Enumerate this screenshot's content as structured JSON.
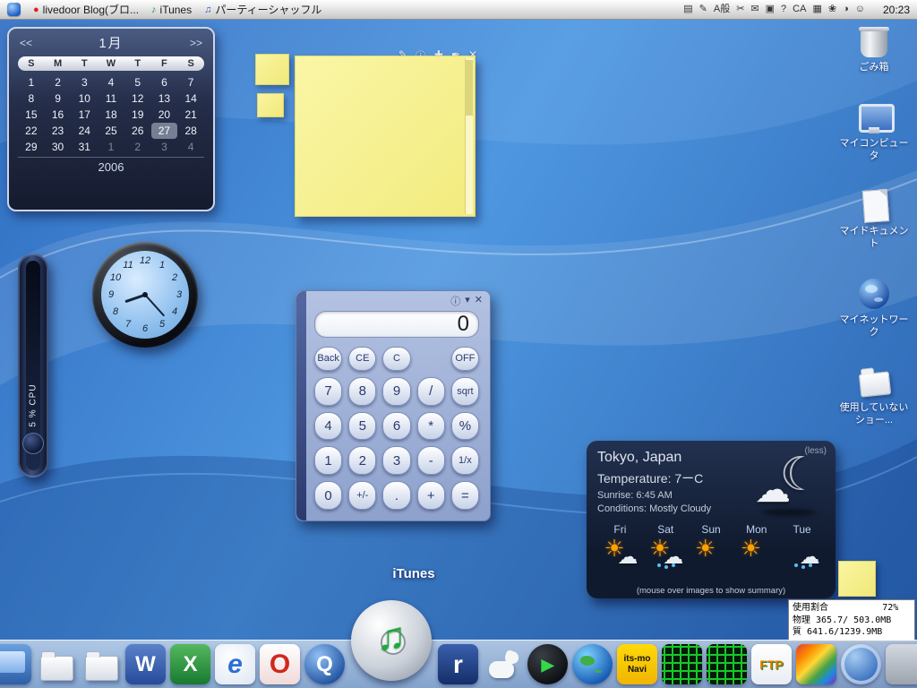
{
  "colors": {
    "wallpaper_blue": "#3a78c8",
    "note_yellow": "#f5ef8e",
    "widget_navy": "#1b2740",
    "dock_silver": "#e8ecf2",
    "calendar_selection_gray": "#cdd6e6",
    "sun_orange": "#ffa000",
    "itunes_green": "#23a83c"
  },
  "menubar": {
    "items": [
      {
        "name": "menu-livedoor-blog",
        "glyph": "●",
        "glyph_class": "red",
        "label": "livedoor Blog(ブロ..."
      },
      {
        "name": "menu-itunes",
        "glyph": "♪",
        "glyph_class": "green",
        "label": "iTunes"
      },
      {
        "name": "menu-party-shuffle",
        "glyph": "♫",
        "glyph_class": "blue",
        "label": "パーティーシャッフル"
      }
    ],
    "tray_icons": [
      {
        "name": "printer-icon",
        "glyph": "▤"
      },
      {
        "name": "pen-icon",
        "glyph": "✎"
      },
      {
        "name": "ime-indicator",
        "glyph": "A般"
      },
      {
        "name": "scissors-icon",
        "glyph": "✂"
      },
      {
        "name": "mail-icon",
        "glyph": "✉"
      },
      {
        "name": "device-icon",
        "glyph": "▣"
      },
      {
        "name": "help-icon",
        "glyph": "?"
      },
      {
        "name": "ca-icon",
        "glyph": "CA"
      },
      {
        "name": "grid-icon",
        "glyph": "▦"
      },
      {
        "name": "flower-icon",
        "glyph": "❀"
      },
      {
        "name": "moon-icon",
        "glyph": "◑"
      },
      {
        "name": "smiley-icon",
        "glyph": "☺"
      }
    ],
    "clock": "20:23"
  },
  "calendar": {
    "prev": "<<",
    "next": ">>",
    "month": "1月",
    "year": "2006",
    "weekdays": [
      "S",
      "M",
      "T",
      "W",
      "T",
      "F",
      "S"
    ],
    "days": [
      {
        "d": "1"
      },
      {
        "d": "2"
      },
      {
        "d": "3"
      },
      {
        "d": "4"
      },
      {
        "d": "5"
      },
      {
        "d": "6"
      },
      {
        "d": "7"
      },
      {
        "d": "8"
      },
      {
        "d": "9"
      },
      {
        "d": "10"
      },
      {
        "d": "11"
      },
      {
        "d": "12"
      },
      {
        "d": "13"
      },
      {
        "d": "14"
      },
      {
        "d": "15"
      },
      {
        "d": "16"
      },
      {
        "d": "17"
      },
      {
        "d": "18"
      },
      {
        "d": "19"
      },
      {
        "d": "20"
      },
      {
        "d": "21"
      },
      {
        "d": "22"
      },
      {
        "d": "23"
      },
      {
        "d": "24"
      },
      {
        "d": "25"
      },
      {
        "d": "26"
      },
      {
        "d": "27",
        "class": "selected"
      },
      {
        "d": "28"
      },
      {
        "d": "29"
      },
      {
        "d": "30"
      },
      {
        "d": "31"
      },
      {
        "d": "1",
        "class": "muted"
      },
      {
        "d": "2",
        "class": "muted"
      },
      {
        "d": "3",
        "class": "muted"
      },
      {
        "d": "4",
        "class": "muted"
      }
    ]
  },
  "notes": {
    "toolbar": [
      {
        "name": "pencil-icon",
        "glyph": "✎"
      },
      {
        "name": "info-icon",
        "glyph": "ⓘ"
      },
      {
        "name": "add-note-icon",
        "glyph": "✚"
      },
      {
        "name": "pen-icon",
        "glyph": "✒"
      },
      {
        "name": "close-icon",
        "glyph": "✕"
      }
    ]
  },
  "analog_clock": {
    "numbers": [
      "12",
      "1",
      "2",
      "3",
      "4",
      "5",
      "6",
      "7",
      "8",
      "9",
      "10",
      "11"
    ]
  },
  "cpu_meter": {
    "label": "5 % CPU"
  },
  "calculator": {
    "display": "0",
    "titlebar_icons": [
      {
        "name": "info-icon",
        "glyph": "ⓘ"
      },
      {
        "name": "collapse-icon",
        "glyph": "▾"
      },
      {
        "name": "close-icon",
        "glyph": "✕"
      }
    ],
    "buttons": [
      {
        "label": "Back",
        "class": "small"
      },
      {
        "label": "CE",
        "class": "small"
      },
      {
        "label": "C",
        "class": "small"
      },
      {
        "label": "",
        "class": "spacer"
      },
      {
        "label": "OFF",
        "class": "small"
      },
      {
        "label": "7"
      },
      {
        "label": "8"
      },
      {
        "label": "9"
      },
      {
        "label": "/"
      },
      {
        "label": "sqrt",
        "class": "small"
      },
      {
        "label": "4"
      },
      {
        "label": "5"
      },
      {
        "label": "6"
      },
      {
        "label": "*"
      },
      {
        "label": "%"
      },
      {
        "label": "1"
      },
      {
        "label": "2"
      },
      {
        "label": "3"
      },
      {
        "label": "-"
      },
      {
        "label": "1/x",
        "class": "small"
      },
      {
        "label": "0"
      },
      {
        "label": "+/-",
        "class": "small"
      },
      {
        "label": "."
      },
      {
        "label": "+"
      },
      {
        "label": "="
      }
    ]
  },
  "weather": {
    "less_link": "(less)",
    "city": "Tokyo,  Japan",
    "temperature": "Temperature:  7ーC",
    "sunrise": "Sunrise:  6:45  AM",
    "conditions": "Conditions:  Mostly  Cloudy",
    "current_icon": "moon-behind-clouds",
    "days": [
      {
        "name": "Fri",
        "icon": "has-sun has-cloud"
      },
      {
        "name": "Sat",
        "icon": "has-sun has-cloud has-rain"
      },
      {
        "name": "Sun",
        "icon": "has-sun"
      },
      {
        "name": "Mon",
        "icon": "has-sun"
      },
      {
        "name": "Tue",
        "icon": "has-cloud has-rain"
      }
    ],
    "footer": "(mouse over images to show summary)"
  },
  "desktop_icons": [
    {
      "name": "icon-trash",
      "kind": "kind-trash",
      "label": "ごみ箱"
    },
    {
      "name": "icon-my-computer",
      "kind": "kind-computer",
      "label": "マイコンピュータ"
    },
    {
      "name": "icon-my-documents",
      "kind": "kind-documents",
      "label": "マイドキュメント"
    },
    {
      "name": "icon-my-network",
      "kind": "kind-network",
      "label": "マイネットワーク"
    },
    {
      "name": "icon-unused-shortcuts",
      "kind": "kind-folder",
      "label": "使用していないショー..."
    }
  ],
  "memory_box": {
    "line1": "使用割合          72%",
    "line2": "物理 365.7/ 503.0MB",
    "line3": "質 641.6/1239.9MB"
  },
  "itunes_label": "iTunes",
  "dock": {
    "icons": [
      {
        "name": "dock-finder",
        "class": "ic-finder",
        "text": ""
      },
      {
        "name": "dock-folder-1",
        "class": "ic-folder",
        "text": ""
      },
      {
        "name": "dock-folder-2",
        "class": "ic-folder",
        "text": ""
      },
      {
        "name": "dock-word",
        "class": "ic-word",
        "text": "W"
      },
      {
        "name": "dock-excel",
        "class": "ic-excel",
        "text": "X"
      },
      {
        "name": "dock-internet-explorer",
        "class": "ic-ie",
        "text": "e"
      },
      {
        "name": "dock-opera",
        "class": "ic-opera",
        "text": "O"
      },
      {
        "name": "dock-quicktime",
        "class": "ic-qt",
        "text": "Q"
      },
      {
        "name": "dock-itunes",
        "class": "ic-itunes",
        "text": "♫"
      },
      {
        "name": "dock-realplayer",
        "class": "ic-real",
        "text": "r"
      },
      {
        "name": "dock-dog",
        "class": "ic-dog",
        "text": ""
      },
      {
        "name": "dock-media-player",
        "class": "ic-player",
        "text": "▶"
      },
      {
        "name": "dock-google-earth",
        "class": "ic-earth",
        "text": ""
      },
      {
        "name": "dock-itsmo-navi",
        "class": "ic-itsmo",
        "text": "its-mo Navi"
      },
      {
        "name": "dock-green-grid-1",
        "class": "ic-grid",
        "text": ""
      },
      {
        "name": "dock-green-grid-2",
        "class": "ic-grid",
        "text": ""
      },
      {
        "name": "dock-ftp",
        "class": "ic-ftp",
        "text": "FTP"
      },
      {
        "name": "dock-palette",
        "class": "ic-palette",
        "text": ""
      },
      {
        "name": "dock-blue-swirl",
        "class": "ic-swirl",
        "text": ""
      },
      {
        "name": "dock-misc",
        "class": "ic-misc",
        "text": ""
      }
    ]
  }
}
